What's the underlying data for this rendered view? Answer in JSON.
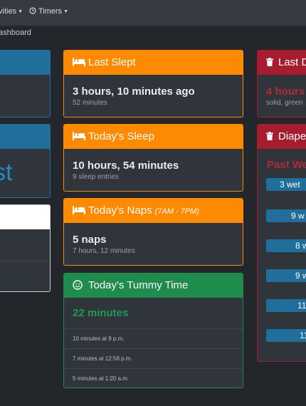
{
  "nav": {
    "activities_label": "vities",
    "timers_label": "Timers",
    "timers_icon": "clock-icon"
  },
  "breadcrumb": {
    "label": "ashboard"
  },
  "colors": {
    "orange": "#fd8a00",
    "red": "#a51d2e",
    "green": "#1f8b4d",
    "blue": "#1f6e9c",
    "card_body": "#30353b",
    "background": "#23272b"
  },
  "left_column": {
    "card2_text": "st"
  },
  "middle_column": {
    "last_slept": {
      "icon": "bed-icon",
      "title": "Last Slept",
      "value": "3 hours, 10 minutes ago",
      "detail": "52 minutes"
    },
    "todays_sleep": {
      "icon": "bed-icon",
      "title": "Today's Sleep",
      "value": "10 hours, 54 minutes",
      "detail": "9 sleep entries"
    },
    "todays_naps": {
      "icon": "bed-icon",
      "title": "Today's Naps",
      "subtitle": "(7AM - 7PM)",
      "value": "5 naps",
      "detail": "7 hours, 12 minutes"
    },
    "tummy_time": {
      "icon": "smile-icon",
      "title": "Today's Tummy Time",
      "value": "22 minutes",
      "entries": [
        "10 minutes at 9 p.m.",
        "7 minutes at 12:58 p.m.",
        "5 minutes at 1:20 a.m."
      ]
    }
  },
  "right_column": {
    "last_diaper": {
      "icon": "trash-icon",
      "title": "Last D",
      "value": "4 hours",
      "detail": "solid, green"
    },
    "diaper_week": {
      "icon": "trash-icon",
      "title": "Diape",
      "subheading": "Past We",
      "bars": [
        "3 wet",
        "9 w",
        "8 w",
        "9 w",
        "11",
        "11"
      ]
    }
  }
}
